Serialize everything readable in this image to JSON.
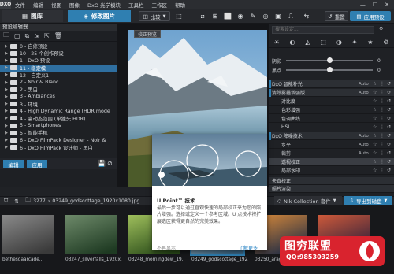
{
  "menubar": {
    "logo": "DXO",
    "items": [
      "文件",
      "编辑",
      "视图",
      "图像",
      "DxO 光学模块",
      "工具栏",
      "工作区",
      "帮助"
    ],
    "window_controls": [
      "—",
      "☐",
      "✕"
    ]
  },
  "toolbar": {
    "library_tab": "图库",
    "customize_tab": "修改图片",
    "compare_label": "比较",
    "reset_label": "重置",
    "apply_preset_label": "应用预设"
  },
  "left_panel": {
    "title": "预设编辑器",
    "tree": [
      {
        "label": "0 - 自修预设",
        "selected": false
      },
      {
        "label": "10 - 25 个创作预设",
        "selected": false
      },
      {
        "label": "1 - DxO 预设",
        "selected": false
      },
      {
        "label": "11 - 稳定模",
        "selected": true
      },
      {
        "label": "12 - 自定义1",
        "selected": false
      },
      {
        "label": "2 - Noir & Blanc",
        "selected": false
      },
      {
        "label": "2 - 黑白",
        "selected": false
      },
      {
        "label": "3 - Ambiances",
        "selected": false
      },
      {
        "label": "3 - 环境",
        "selected": false
      },
      {
        "label": "4 - High Dynamic Range (HDR mode",
        "selected": false
      },
      {
        "label": "4 - 高动态范围 (单独头 HDR)",
        "selected": false
      },
      {
        "label": "5 - Smartphones",
        "selected": false
      },
      {
        "label": "5 - 智能手机",
        "selected": false
      },
      {
        "label": "6 - DxO FilmPack Designer - Noir &",
        "selected": false
      },
      {
        "label": "6 - DxO FilmPack 设计师 - 黑白",
        "selected": false
      }
    ],
    "edit_button": "编辑",
    "apply_button": "应用"
  },
  "center": {
    "compare_badge": "校正预览"
  },
  "right_panel": {
    "search_placeholder": "搜索设定...",
    "sliders": [
      {
        "label": "阴影",
        "value": "0",
        "position": 0.5
      },
      {
        "label": "黑点",
        "value": "0",
        "position": 0.5
      }
    ],
    "palettes": [
      {
        "label": "DxO 智能补光",
        "auto": "Auto",
        "header": true,
        "flag": true
      },
      {
        "label": "清除雾霾增强版",
        "auto": "Auto",
        "header": true,
        "flag": true
      },
      {
        "label": "对比度",
        "auto": "",
        "header": false
      },
      {
        "label": "色彩增强",
        "auto": "",
        "header": false
      },
      {
        "label": "色调曲线",
        "auto": "",
        "header": false
      },
      {
        "label": "HSL",
        "auto": "",
        "header": false
      },
      {
        "label": "DxO 降噪技术",
        "auto": "Auto",
        "header": true,
        "flag": true
      },
      {
        "label": "水平",
        "auto": "Auto",
        "header": false
      },
      {
        "label": "裁剪",
        "auto": "Auto",
        "header": false
      },
      {
        "label": "透视校正",
        "auto": "",
        "header": false,
        "highlight": true
      },
      {
        "label": "局部水印",
        "auto": "",
        "header": false
      }
    ],
    "sections": [
      "失真校正",
      "照片渲染"
    ]
  },
  "strip_bar": {
    "count": "3277",
    "path": "03249_godscottage_1920x1080.jpg",
    "nik_label": "Nik Collection 套件",
    "export_label": "导出到磁盘"
  },
  "filmstrip": {
    "thumbs": [
      {
        "caption": "bethesdaarcade...",
        "tone": [
          "#3a3a3a",
          "#8a8a8a"
        ]
      },
      {
        "caption": "03247_silverfalls_1920x...",
        "tone": [
          "#1e3a22",
          "#6e8a6a"
        ]
      },
      {
        "caption": "03248_morningdew_19...",
        "tone": [
          "#2b4d1a",
          "#9fbf5c"
        ]
      },
      {
        "caption": "03249_godscottage_192...",
        "tone": [
          "#3e6b8a",
          "#d9e6ef"
        ]
      },
      {
        "caption": "03250_aragolighthouse_...",
        "tone": [
          "#1e2a44",
          "#d98a3a"
        ]
      },
      {
        "caption": "",
        "tone": [
          "#2a1e3a",
          "#cf5a3a"
        ]
      }
    ]
  },
  "popup": {
    "title": "U Point™ 技术",
    "body": "最后一步可以通过直观快速的局部校正来为您的照片增强。选择或定义一个参考区域。U 点技术将扩展选区获得更自然的完美效果。",
    "skip_label": "不再显示",
    "more_label": "了解更多"
  },
  "watermark": {
    "title": "图穷联盟",
    "qq": "QQ:985303259"
  },
  "colors": {
    "accent": "#2f7fb1",
    "panel_bg": "#1f2125",
    "watermark_red": "#d9232e"
  }
}
